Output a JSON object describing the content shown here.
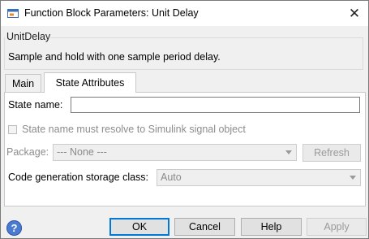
{
  "window": {
    "title": "Function Block Parameters: Unit Delay",
    "close_glyph": "✕"
  },
  "block": {
    "name": "UnitDelay",
    "description": "Sample and hold with one sample period delay."
  },
  "tabs": [
    {
      "label": "Main",
      "active": false
    },
    {
      "label": "State Attributes",
      "active": true
    }
  ],
  "state": {
    "state_name_label": "State name:",
    "state_name_value": "",
    "resolve_checkbox_label": "State name must resolve to Simulink signal object",
    "resolve_checked": false,
    "package_label": "Package:",
    "package_value": "--- None ---",
    "refresh_label": "Refresh",
    "storage_class_label": "Code generation storage class:",
    "storage_class_value": "Auto"
  },
  "footer": {
    "help_icon_glyph": "?",
    "ok_label": "OK",
    "cancel_label": "Cancel",
    "help_label": "Help",
    "apply_label": "Apply"
  },
  "colors": {
    "accent": "#0078d7",
    "help_icon": "#4a7bd0"
  }
}
